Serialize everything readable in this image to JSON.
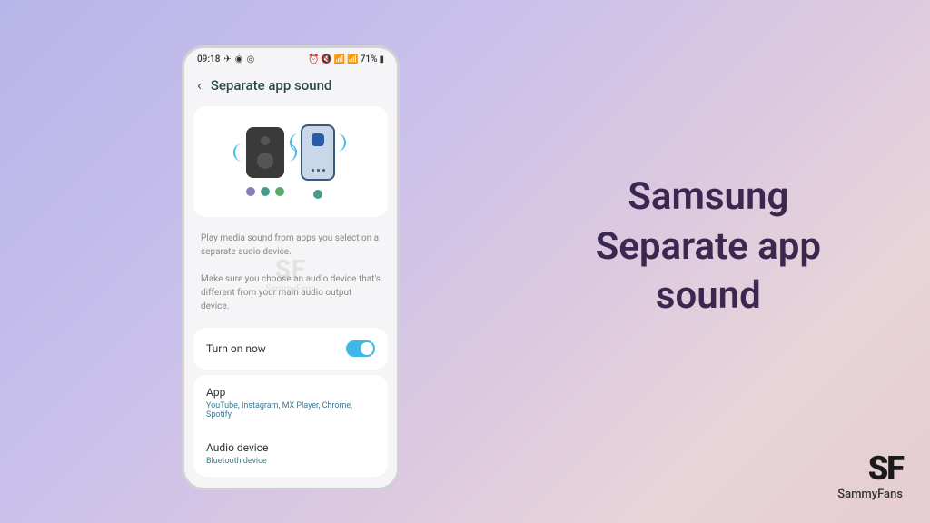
{
  "statusBar": {
    "time": "09:18",
    "battery": "71%"
  },
  "header": {
    "title": "Separate app sound"
  },
  "description": {
    "line1": "Play media sound from apps you select on a separate audio device.",
    "line2": "Make sure you choose an audio device that's different from your main audio output device."
  },
  "watermark": {
    "main": "SF",
    "sub": "SammyFans"
  },
  "toggle": {
    "label": "Turn on now"
  },
  "settings": {
    "app": {
      "title": "App",
      "value": "YouTube, Instagram, MX Player, Chrome, Spotify"
    },
    "audioDevice": {
      "title": "Audio device",
      "value": "Bluetooth device"
    }
  },
  "promo": {
    "title": "Samsung\nSeparate app\nsound"
  },
  "branding": {
    "logo": "SF",
    "name": "SammyFans"
  }
}
